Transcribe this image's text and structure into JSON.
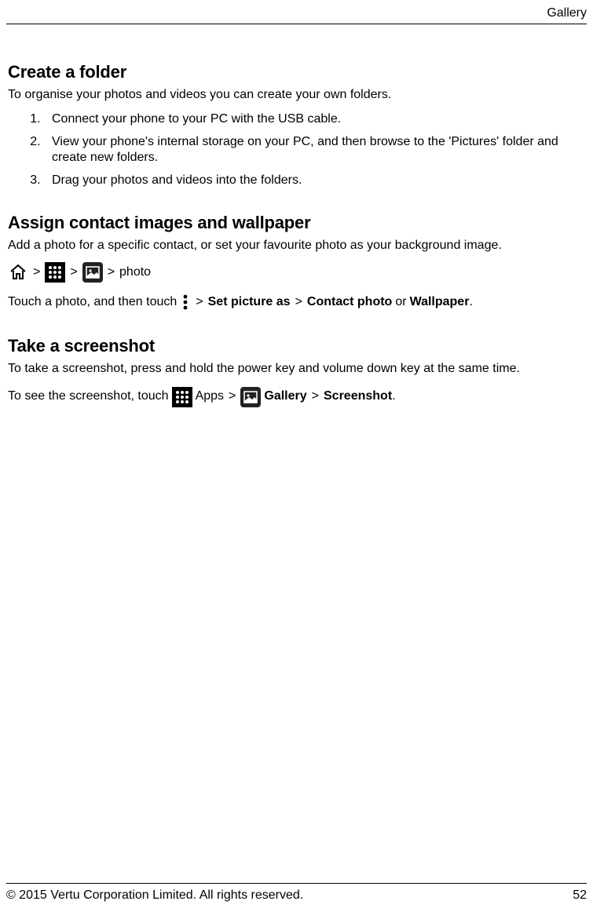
{
  "header": {
    "title": "Gallery"
  },
  "sections": {
    "create_folder": {
      "heading": "Create a folder",
      "intro": "To organise your photos and videos you can create your own folders.",
      "steps": [
        "Connect your phone to your PC with the USB cable.",
        "View your phone's internal storage on your PC, and then browse to the 'Pictures' folder and create new folders.",
        "Drag your photos and videos into the folders."
      ]
    },
    "assign": {
      "heading": "Assign contact images and wallpaper",
      "intro": "Add a photo for a specific contact, or set your favourite photo as your background image.",
      "nav_tail": "photo",
      "line2_prefix": "Touch a photo, and then touch",
      "set_picture_as": "Set picture as",
      "contact_photo": "Contact photo",
      "or": "or",
      "wallpaper": "Wallpaper",
      "period": "."
    },
    "screenshot": {
      "heading": "Take a screenshot",
      "intro": "To take a screenshot, press and hold the power key and volume down key at the same time.",
      "line2_prefix": "To see the screenshot, touch",
      "apps_label": "Apps",
      "gallery": "Gallery",
      "screenshot_word": "Screenshot",
      "period": "."
    }
  },
  "separators": {
    "gt": ">"
  },
  "footer": {
    "copyright": "© 2015 Vertu Corporation Limited. All rights reserved.",
    "page": "52"
  }
}
